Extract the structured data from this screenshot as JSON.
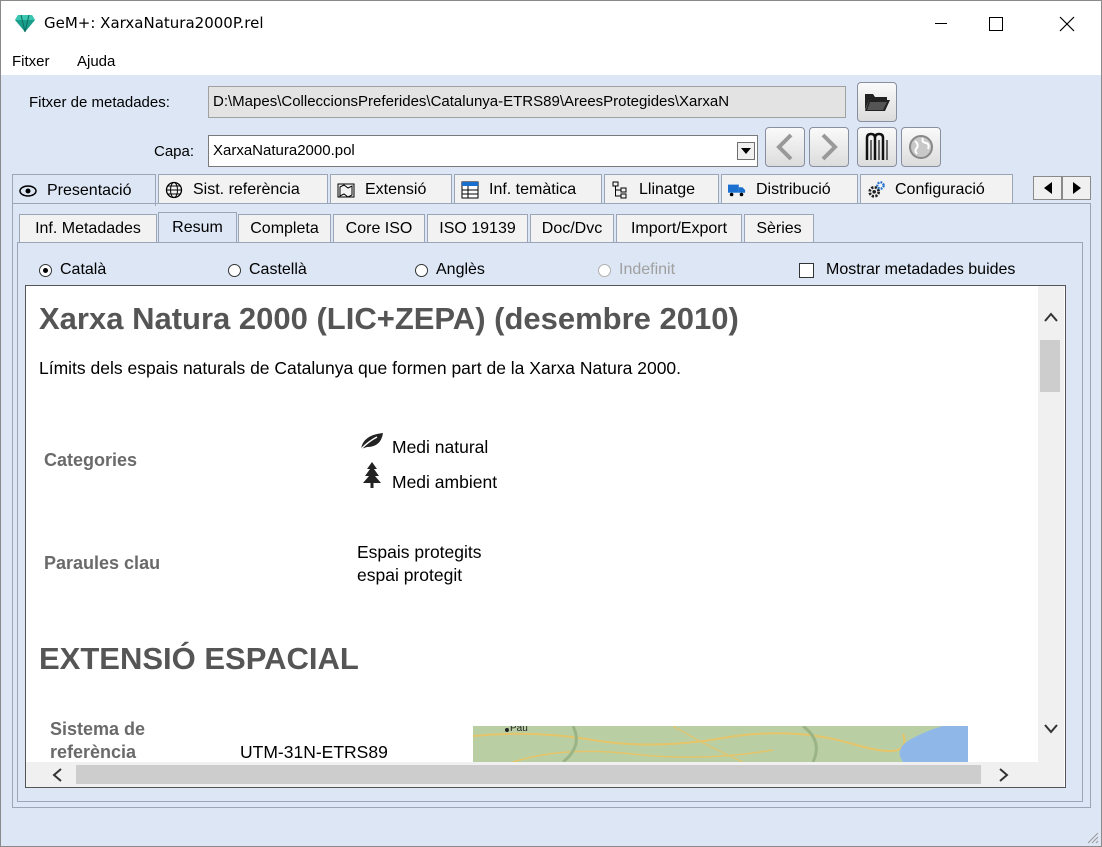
{
  "window": {
    "title": "GeM+: XarxaNatura2000P.rel",
    "minimize": "—",
    "maximize": "☐",
    "close": "✕"
  },
  "menu": [
    "Fitxer",
    "Ajuda"
  ],
  "metadata_file": {
    "label": "Fitxer de metadades:",
    "value": "D:\\Mapes\\ColleccionsPreferides\\Catalunya-ETRS89\\AreesProtegides\\XarxaN"
  },
  "layer": {
    "label": "Capa:",
    "value": "XarxaNatura2000.pol"
  },
  "main_tabs": [
    {
      "label": "Presentació",
      "icon": "eye-icon"
    },
    {
      "label": "Sist. referència",
      "icon": "globe-icon"
    },
    {
      "label": "Extensió",
      "icon": "map-extent-icon"
    },
    {
      "label": "Inf. temàtica",
      "icon": "table-icon"
    },
    {
      "label": "Llinatge",
      "icon": "tree-hierarchy-icon"
    },
    {
      "label": "Distribució",
      "icon": "truck-icon"
    },
    {
      "label": "Configuració",
      "icon": "gears-icon"
    }
  ],
  "sub_tabs": [
    "Inf. Metadades",
    "Resum",
    "Completa",
    "Core ISO",
    "ISO 19139",
    "Doc/Dvc",
    "Import/Export",
    "Sèries"
  ],
  "active_sub_tab": "Resum",
  "languages": [
    {
      "label": "Català",
      "selected": true,
      "enabled": true
    },
    {
      "label": "Castellà",
      "selected": false,
      "enabled": true
    },
    {
      "label": "Anglès",
      "selected": false,
      "enabled": true
    },
    {
      "label": "Indefinit",
      "selected": false,
      "enabled": false
    }
  ],
  "show_empty": {
    "label": "Mostrar metadades buides",
    "checked": false
  },
  "document": {
    "title": "Xarxa Natura 2000 (LIC+ZEPA) (desembre 2010)",
    "description": "Límits dels espais naturals de Catalunya que formen part de la Xarxa Natura 2000.",
    "categories_label": "Categories",
    "categories": [
      {
        "label": "Medi natural",
        "icon": "leaf-icon"
      },
      {
        "label": "Medi ambient",
        "icon": "pine-tree-icon"
      }
    ],
    "keywords_label": "Paraules clau",
    "keywords": [
      "Espais protegits",
      "espai protegit"
    ],
    "extent_heading": "EXTENSIÓ ESPACIAL",
    "ref_system_label_1": "Sistema de",
    "ref_system_label_2": "referència",
    "ref_system_value": "UTM-31N-ETRS89",
    "map_place": "Pau"
  },
  "colors": {
    "window_bg": "#dce6f4",
    "heading_gray": "#555555",
    "label_gray": "#6a6a6a",
    "map_sea": "#8fb8e8",
    "map_land": "#b9cfa3"
  }
}
